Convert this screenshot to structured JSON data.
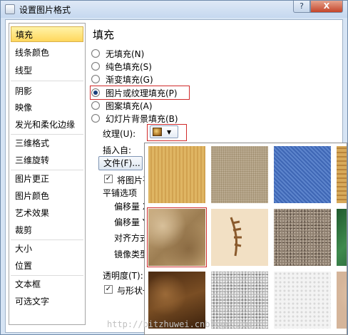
{
  "window": {
    "title": "设置图片格式",
    "help_label": "?",
    "close_label": "X"
  },
  "nav": {
    "items": [
      {
        "label": "填充",
        "selected": true
      },
      {
        "label": "线条颜色"
      },
      {
        "label": "线型"
      },
      {
        "label": "阴影"
      },
      {
        "label": "映像"
      },
      {
        "label": "发光和柔化边缘"
      },
      {
        "label": "三维格式"
      },
      {
        "label": "三维旋转"
      },
      {
        "label": "图片更正"
      },
      {
        "label": "图片颜色"
      },
      {
        "label": "艺术效果"
      },
      {
        "label": "裁剪"
      },
      {
        "label": "大小"
      },
      {
        "label": "位置"
      },
      {
        "label": "文本框"
      },
      {
        "label": "可选文字"
      }
    ]
  },
  "panel": {
    "heading": "填充",
    "fill_options": [
      {
        "label": "无填充(N)"
      },
      {
        "label": "纯色填充(S)"
      },
      {
        "label": "渐变填充(G)"
      },
      {
        "label": "图片或纹理填充(P)",
        "checked": true
      },
      {
        "label": "图案填充(A)"
      },
      {
        "label": "幻灯片背景填充(B)"
      }
    ],
    "texture_label": "纹理(U):",
    "insert_from_label": "插入自:",
    "file_button": "文件(F)...",
    "tile_checkbox_label": "将图片平",
    "tile_options_label": "平铺选项",
    "offset_x_label": "偏移量 X",
    "offset_y_label": "偏移量 Y",
    "alignment_label": "对齐方式",
    "mirror_label": "镜像类型",
    "transparency_label": "透明度(T):",
    "rotate_checkbox_label": "与形状一"
  },
  "gallery": {
    "textures": [
      {
        "name": "papyrus"
      },
      {
        "name": "canvas"
      },
      {
        "name": "denim"
      },
      {
        "name": "woven-mat"
      },
      {
        "name": "crumpled-paper",
        "selected": true
      },
      {
        "name": "fish-fossil"
      },
      {
        "name": "sand"
      },
      {
        "name": "green-marble"
      },
      {
        "name": "brown-marble"
      },
      {
        "name": "granite"
      },
      {
        "name": "white-marble"
      },
      {
        "name": "bouquet"
      }
    ]
  },
  "watermark": "http://bitzhuwei.cnblogs.com"
}
